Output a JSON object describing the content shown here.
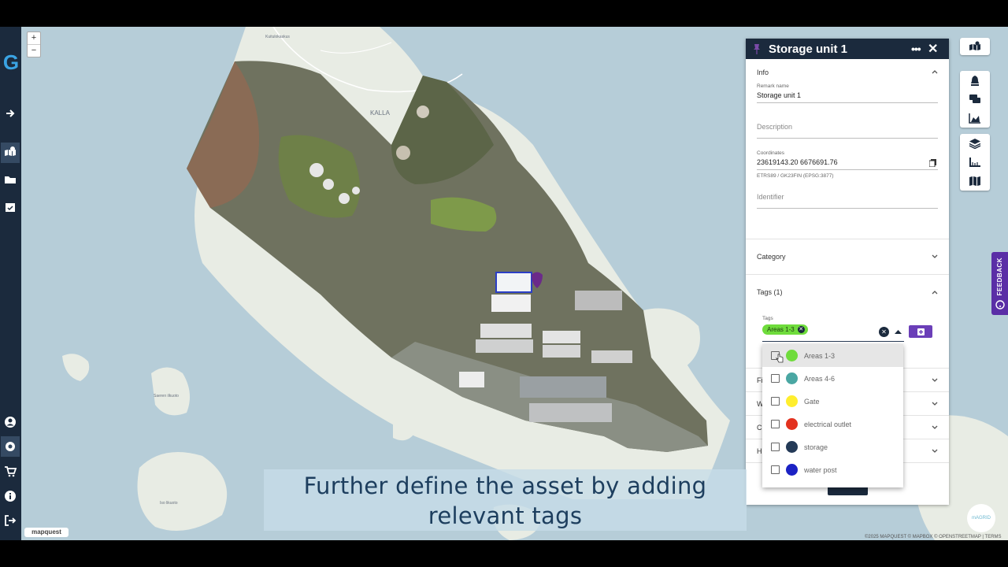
{
  "sidebar": {
    "logo": "G",
    "icons": [
      "arrow-right-icon",
      "map-icon",
      "folder-icon",
      "calendar-check-icon",
      "user-icon",
      "settings-icon",
      "cart-icon",
      "info-icon",
      "logout-icon"
    ]
  },
  "map": {
    "zoom_in": "+",
    "zoom_out": "−",
    "labels": {
      "kallahti": "KALLA",
      "kaitalokaskus": "Kuitulokaskus",
      "saeren": "Saeren ilkuoto",
      "iso": "Iso likuoto"
    },
    "provider_logo": "mapquest",
    "attribution": "©2025 MAPQUEST  © MAPBOX  © OPENSTREETMAP  |  TERMS"
  },
  "panel": {
    "title": "Storage unit 1",
    "info_header": "Info",
    "remark_label": "Remark name",
    "remark_value": "Storage unit 1",
    "description_placeholder": "Description",
    "coordinates_label": "Coordinates",
    "coordinates_value": "23619143.20 6676691.76",
    "coordinates_hint": "ETRS89 / GK23FIN (EPSG:3877)",
    "identifier_placeholder": "Identifier",
    "category_header": "Category",
    "tags_header": "Tags (1)",
    "tags_label": "Tags",
    "selected_tag": "Areas 1-3",
    "collapsed_sections": [
      "Fi",
      "W",
      "C",
      "H"
    ]
  },
  "tag_options": [
    {
      "label": "Areas 1-3",
      "color": "#6fdc3c",
      "checked": false
    },
    {
      "label": "Areas 4-6",
      "color": "#4aa7a3",
      "checked": false
    },
    {
      "label": "Gate",
      "color": "#ffee2e",
      "checked": false
    },
    {
      "label": "electrical outlet",
      "color": "#e3321f",
      "checked": false
    },
    {
      "label": "storage",
      "color": "#243a57",
      "checked": false
    },
    {
      "label": "water post",
      "color": "#1b22c4",
      "checked": false
    }
  ],
  "feedback_label": "FEEDBACK",
  "badge_text": "mAGRID",
  "caption": {
    "line1": "Further define the asset by adding",
    "line2": "relevant tags"
  },
  "colors": {
    "navy": "#1b2a3d",
    "accent_purple": "#5a2ea6",
    "sea": "#b6cdd8",
    "land": "#e9eee6"
  }
}
